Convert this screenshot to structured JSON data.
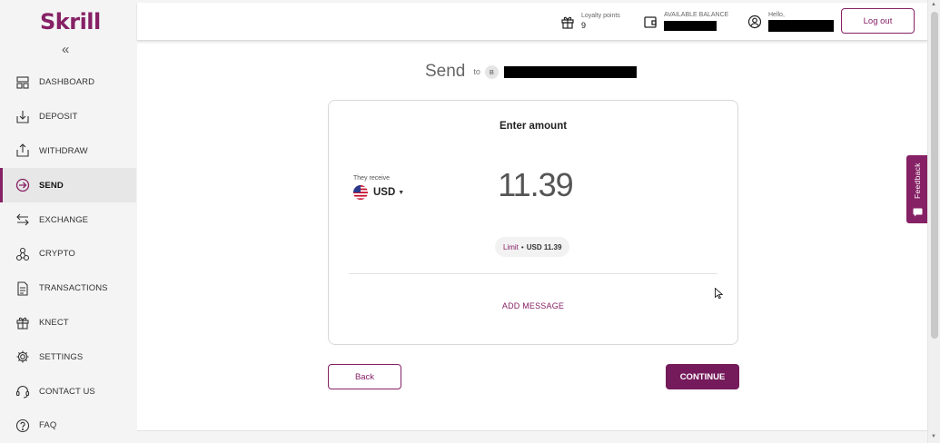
{
  "brand": {
    "logo_text": "Skrill",
    "accent_color": "#862165"
  },
  "sidebar": {
    "collapse_icon": "double-chevron-left-icon",
    "items": [
      {
        "label": "DASHBOARD",
        "icon": "dashboard-icon",
        "active": false
      },
      {
        "label": "DEPOSIT",
        "icon": "deposit-icon",
        "active": false
      },
      {
        "label": "WITHDRAW",
        "icon": "withdraw-icon",
        "active": false
      },
      {
        "label": "SEND",
        "icon": "send-icon",
        "active": true
      },
      {
        "label": "EXCHANGE",
        "icon": "exchange-icon",
        "active": false
      },
      {
        "label": "CRYPTO",
        "icon": "crypto-icon",
        "active": false
      },
      {
        "label": "TRANSACTIONS",
        "icon": "transactions-icon",
        "active": false
      },
      {
        "label": "KNECT",
        "icon": "gift-icon",
        "active": false
      },
      {
        "label": "SETTINGS",
        "icon": "gear-icon",
        "active": false
      },
      {
        "label": "CONTACT US",
        "icon": "headset-icon",
        "active": false
      },
      {
        "label": "FAQ",
        "icon": "question-icon",
        "active": false
      }
    ]
  },
  "header": {
    "loyalty": {
      "label": "Loyalty points",
      "value": "9"
    },
    "balance": {
      "label": "AVAILABLE BALANCE"
    },
    "user": {
      "label": "Hello,"
    },
    "logout_label": "Log out"
  },
  "send": {
    "title": "Send",
    "to_label": "to",
    "recipient_initial": "B"
  },
  "card": {
    "title": "Enter amount",
    "receive_label": "They receive",
    "currency": "USD",
    "amount": "11.39",
    "limit_label": "Limit",
    "limit_separator": "•",
    "limit_value": "USD 11.39",
    "add_message": "ADD MESSAGE"
  },
  "actions": {
    "back": "Back",
    "continue": "CONTINUE"
  },
  "feedback": {
    "label": "Feedback"
  }
}
